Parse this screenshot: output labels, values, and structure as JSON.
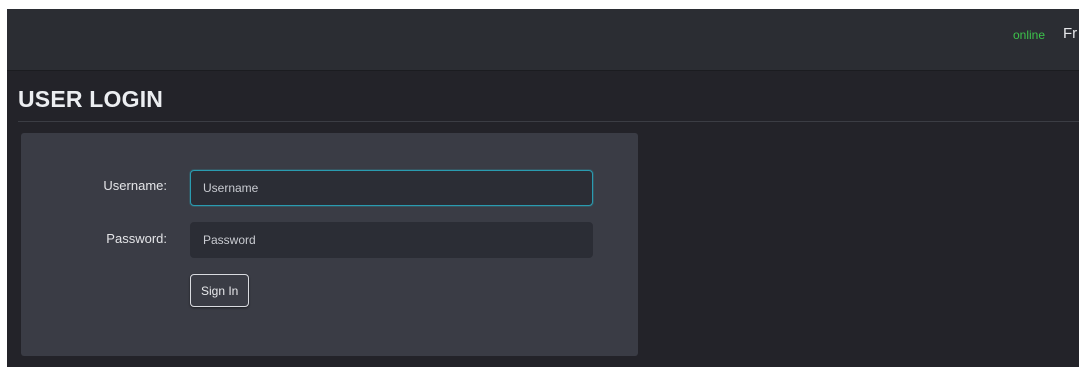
{
  "header": {
    "status": "online",
    "user_name": "Fr"
  },
  "page": {
    "title": "USER LOGIN"
  },
  "login_form": {
    "username_label": "Username:",
    "username_placeholder": "Username",
    "username_value": "",
    "password_label": "Password:",
    "password_placeholder": "Password",
    "password_value": "",
    "signin_label": "Sign In"
  },
  "colors": {
    "status_online": "#3cc34b",
    "focus_border": "#2a9bb0",
    "background": "#232329",
    "panel": "#3a3c45",
    "topbar": "#2b2d33"
  }
}
